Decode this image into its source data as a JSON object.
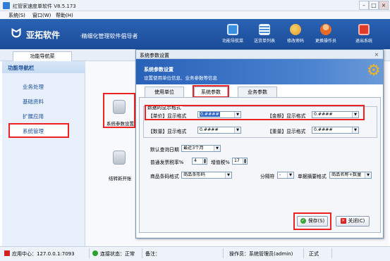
{
  "window": {
    "title": "红管家速度单软件 V8.5.173"
  },
  "menu": [
    "系统(S)",
    "窗口(W)",
    "帮助(H)"
  ],
  "header": {
    "logo_mark": "ข",
    "logo_text": "亚拓软件",
    "slogan": "·精细化管理软件倡导者",
    "toolbar": [
      {
        "label": "功能导航菜",
        "icon": "monitor-icon",
        "color": "#3b8fe0"
      },
      {
        "label": "送货单列表",
        "icon": "list-icon",
        "color": "#4a90d9"
      },
      {
        "label": "修改密码",
        "icon": "key-icon",
        "color": "#f0b43c"
      },
      {
        "label": "更换操作员",
        "icon": "user-icon",
        "color": "#f08a2a"
      },
      {
        "label": "退出系统",
        "icon": "power-icon",
        "color": "#e03a2a"
      }
    ]
  },
  "nav_tab": "功能导航菜",
  "left_panel": {
    "title": "功能导航栏",
    "items": [
      "业务处理",
      "基础资料",
      "扩展应用",
      "系统管理"
    ],
    "active_item": "系统管理"
  },
  "modules": [
    {
      "label": "系统参数设置",
      "icon": "database-gear-icon"
    },
    {
      "label": "结转新开账",
      "icon": "database-add-icon"
    }
  ],
  "dialog": {
    "title": "系统参数设置",
    "close": "×",
    "banner_title": "系统参数设置",
    "banner_sub": "设置使用单位信息、业务参数等信息",
    "tabs": [
      "使用单位",
      "系统参数",
      "业务参数"
    ],
    "active_tab": "系统参数",
    "number_format": {
      "group_label": "数据的显示格式",
      "price_label": "【单价】显示格式",
      "price_value": "0.####",
      "amount_label": "【金额】显示格式",
      "amount_value": "0.####",
      "quantity_label": "【数量】显示格式",
      "quantity_value": "0.####",
      "weight_label": "【重量】显示格式",
      "weight_value": "0.####"
    },
    "default_query_label": "默认查询日期",
    "default_query_value": "最近3个月",
    "invoice_tax_label": "普通发票税率%",
    "invoice_tax_value": "4",
    "vat_label": "增值税%",
    "vat_value": "17",
    "barcode_label": "商品条码格式",
    "barcode_value": "商品条形码",
    "separator_label": "分隔符",
    "separator_value": "-",
    "doc_summary_label": "单据摘要格式",
    "doc_summary_value": "商品名称+数量",
    "save_label": "保存(S)",
    "close_label": "关闭(C)"
  },
  "status": {
    "app_center": "应用中心：127.0.0.1:7093",
    "connection": "连接状态：正常",
    "notes_label": "备注：",
    "operator": "操作员：系统管理员(admin)",
    "mode": "正式"
  },
  "colors": {
    "accent": "#1a4c98",
    "highlight": "#e22222",
    "ok": "#3aa63a"
  }
}
